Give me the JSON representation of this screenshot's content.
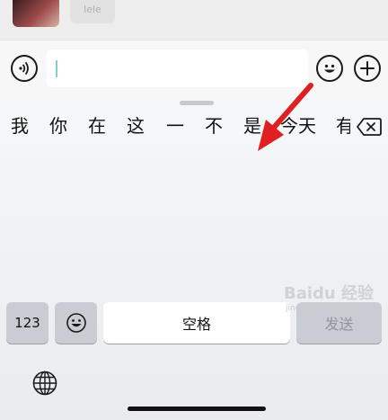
{
  "chat": {
    "contact_name": "lele"
  },
  "input": {
    "value": ""
  },
  "keyboard": {
    "candidates": [
      "我",
      "你",
      "在",
      "这",
      "一",
      "不",
      "是",
      "今天",
      "有"
    ],
    "key_123": "123",
    "key_space": "空格",
    "key_send": "发送"
  },
  "watermark": {
    "title": "Baidu 经验",
    "url": "jingyan.baidu.com"
  },
  "colors": {
    "annotation_arrow": "#e02020",
    "cursor": "#7fd0c7"
  },
  "icons": [
    "voice-icon",
    "emoji-icon",
    "plus-icon",
    "backspace-icon",
    "globe-icon"
  ]
}
